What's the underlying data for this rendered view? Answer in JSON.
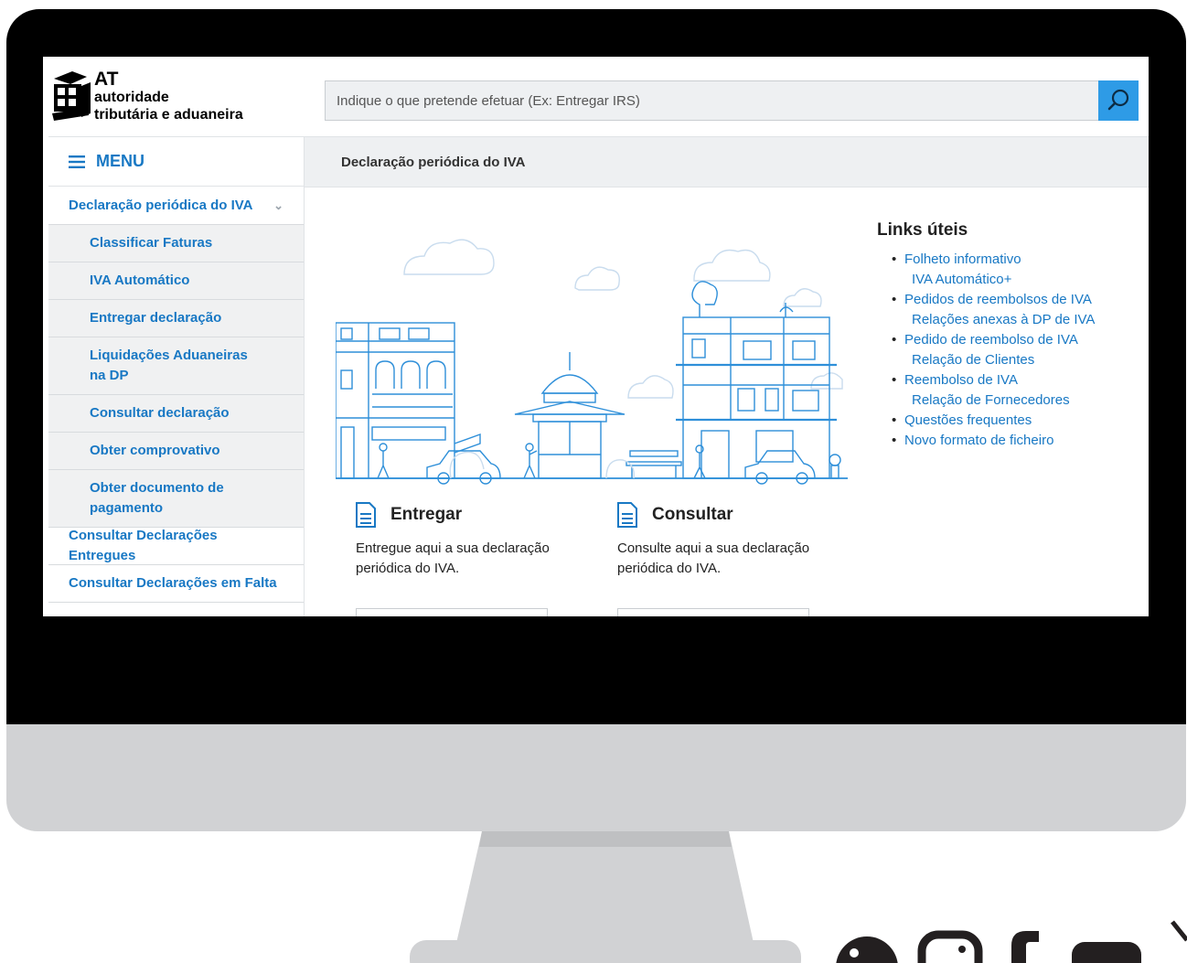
{
  "logo": {
    "at": "AT",
    "line1": "autoridade",
    "line2": "tributária e aduaneira"
  },
  "search": {
    "placeholder": "Indique o que pretende efetuar (Ex: Entregar IRS)"
  },
  "menu": {
    "label": "MENU"
  },
  "sidebar": {
    "items": [
      {
        "label": "Declaração periódica do IVA",
        "level": "top",
        "expanded": true
      },
      {
        "label": "Classificar Faturas",
        "level": "sub"
      },
      {
        "label": "IVA Automático",
        "level": "sub"
      },
      {
        "label": "Entregar declaração",
        "level": "sub"
      },
      {
        "label": "Liquidações Aduaneiras na DP",
        "level": "sub"
      },
      {
        "label": "Consultar declaração",
        "level": "sub"
      },
      {
        "label": "Obter comprovativo",
        "level": "sub"
      },
      {
        "label": "Obter documento de pagamento",
        "level": "sub"
      },
      {
        "label": "Consultar Declarações Entregues",
        "level": "top"
      },
      {
        "label": "Consultar Declarações em Falta",
        "level": "top"
      }
    ]
  },
  "breadcrumb": "Declaração periódica do IVA",
  "cards": [
    {
      "title": "Entregar",
      "desc": "Entregue aqui a sua declaração periódica do IVA."
    },
    {
      "title": "Consultar",
      "desc": "Consulte aqui a sua declaração periódica do IVA."
    }
  ],
  "links": {
    "title": "Links úteis",
    "items": [
      {
        "line1": "Folheto informativo",
        "line2": "IVA Automático+"
      },
      {
        "line1": "Pedidos de reembolsos de IVA",
        "line2": "Relações anexas à DP de IVA"
      },
      {
        "line1": "Pedido de reembolso de IVA",
        "line2": "Relação de Clientes"
      },
      {
        "line1": "Reembolso de IVA",
        "line2": "Relação de Fornecedores"
      },
      {
        "line1": "Questões frequentes",
        "line2": ""
      },
      {
        "line1": "Novo formato de ficheiro",
        "line2": ""
      }
    ]
  },
  "colors": {
    "link": "#1878c4",
    "search_button": "#2e9be6",
    "illustration": "#2e8fd9",
    "monitor_chin": "#d1d2d4"
  },
  "icons": [
    "hamburger-icon",
    "search-icon",
    "chevron-down-icon",
    "document-icon",
    "linkedin-icon",
    "instagram-icon",
    "facebook-icon",
    "youtube-icon",
    "x-icon"
  ]
}
